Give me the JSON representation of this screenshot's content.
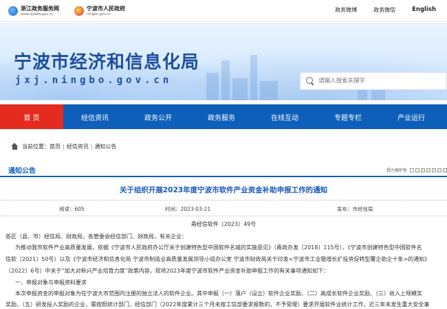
{
  "topbar": {
    "logo1": {
      "cn": "浙江政务服务网",
      "en": "www.zjzwfw.gov.cn"
    },
    "logo2": {
      "cn": "宁波市人民政府",
      "en": "ningbo.gov.cn"
    },
    "links": [
      "政务微博",
      "政务微信",
      "English"
    ]
  },
  "banner": {
    "title": "宁波市经济和信息化局",
    "domain": "jxj.ningbo.gov.cn",
    "search_placeholder": "请输入搜索关键字"
  },
  "nav": [
    "首 页",
    "经信资讯",
    "政务公开",
    "政务服务",
    "在线互动",
    "专题专栏",
    "产业运行"
  ],
  "breadcrumb": {
    "label": "当前位置：",
    "items": [
      "首页",
      "经信资讯",
      "通知公告"
    ]
  },
  "section": {
    "title": "通知公告",
    "fontsize_label": "视力保护色"
  },
  "article": {
    "title": "关于组织开展2023年度宁波市软件产业资金补助申报工作的通知",
    "views_label": "阅读：605",
    "date_label": "时间：2023-03-21",
    "source_label": "发布：市经信局",
    "doc_no": "甬经信软件〔2023〕49号",
    "paragraphs": [
      "各区（县、市）经信局、财政局，各管委会经信部门、财政局，有关企业：",
      "为推动我市软件产业高质量发展，依据《宁波市人民政府办公厅关于创建特色型中国软件名城的实施意见》（甬政办发〔2018〕115号）、《宁波市创建特色型中国软件名",
      "信软〔2021〕50号）以及《宁波市经济和信息化局 宁波市制造业高质量发展领导小组办公室 宁波市财政局关于印发<宁波市工业稳增长扩投资促转型覆企助企十条>的通知》",
      "〔2022〕6号）中关于“加大对新兴产业培育力度”政策内容，现将2023年度宁波市软件产业资金补助申报工作的有关事项通知如下：",
      "一、申报对象与申报资料要求",
      "本次申报资金的申报对象为在宁波大市范围内注册的独立法人的软件企业。其中申报（一）落户（设立）软件企业奖励、（二）高成长软件企业奖励、（三）收入上规模奖",
      "奖励、（五）研发投入奖励的企业，需按照统计部门、经信部门（2022年度累计三个月未按工信部要求报数的，不予受理）要求开展软件业统计工作，近三年未发生重大安全事"
    ]
  },
  "colors": {
    "nav_bg": "#0d5fb9",
    "nav_active": "#e32b1f",
    "title_blue": "#1e4f9c",
    "article_title": "#1a56b8",
    "swatches": [
      "#ffffff",
      "#fbf5dd",
      "#f8e9c3",
      "#e3f3d8",
      "#e7eef8",
      "#efefef",
      "#f1e4f1"
    ]
  }
}
